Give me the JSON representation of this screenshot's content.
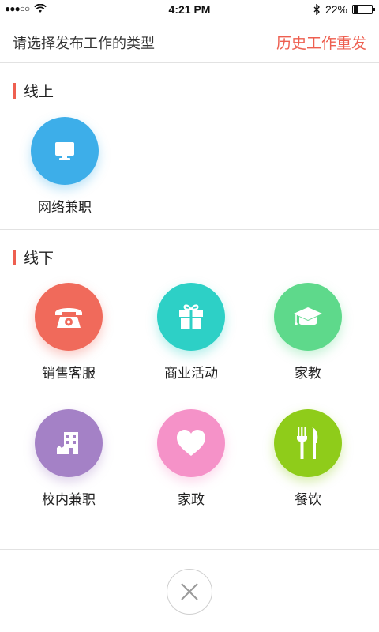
{
  "status_bar": {
    "time": "4:21 PM",
    "battery_text": "22%",
    "battery_level": 0.22,
    "signal_icon": "signal-dots-icon",
    "wifi_icon": "wifi-icon",
    "bluetooth_icon": "bluetooth-icon"
  },
  "header": {
    "title": "请选择发布工作的类型",
    "action_label": "历史工作重发"
  },
  "sections": {
    "online": {
      "title": "线上",
      "items": [
        {
          "label": "网络兼职",
          "icon": "monitor-icon",
          "color": "#3daee9"
        }
      ]
    },
    "offline": {
      "title": "线下",
      "items": [
        {
          "label": "销售客服",
          "icon": "telephone-icon",
          "color": "#f06a5b"
        },
        {
          "label": "商业活动",
          "icon": "gift-icon",
          "color": "#2dd0c6"
        },
        {
          "label": "家教",
          "icon": "graduation-cap-icon",
          "color": "#5ed98b"
        },
        {
          "label": "校内兼职",
          "icon": "building-icon",
          "color": "#a481c6"
        },
        {
          "label": "家政",
          "icon": "heart-icon",
          "color": "#f592c8"
        },
        {
          "label": "餐饮",
          "icon": "fork-knife-icon",
          "color": "#8fcc1a"
        }
      ]
    }
  },
  "footer": {
    "close_icon": "close-icon"
  },
  "colors": {
    "accent": "#ee5f50",
    "divider": "#e2e2e2"
  }
}
